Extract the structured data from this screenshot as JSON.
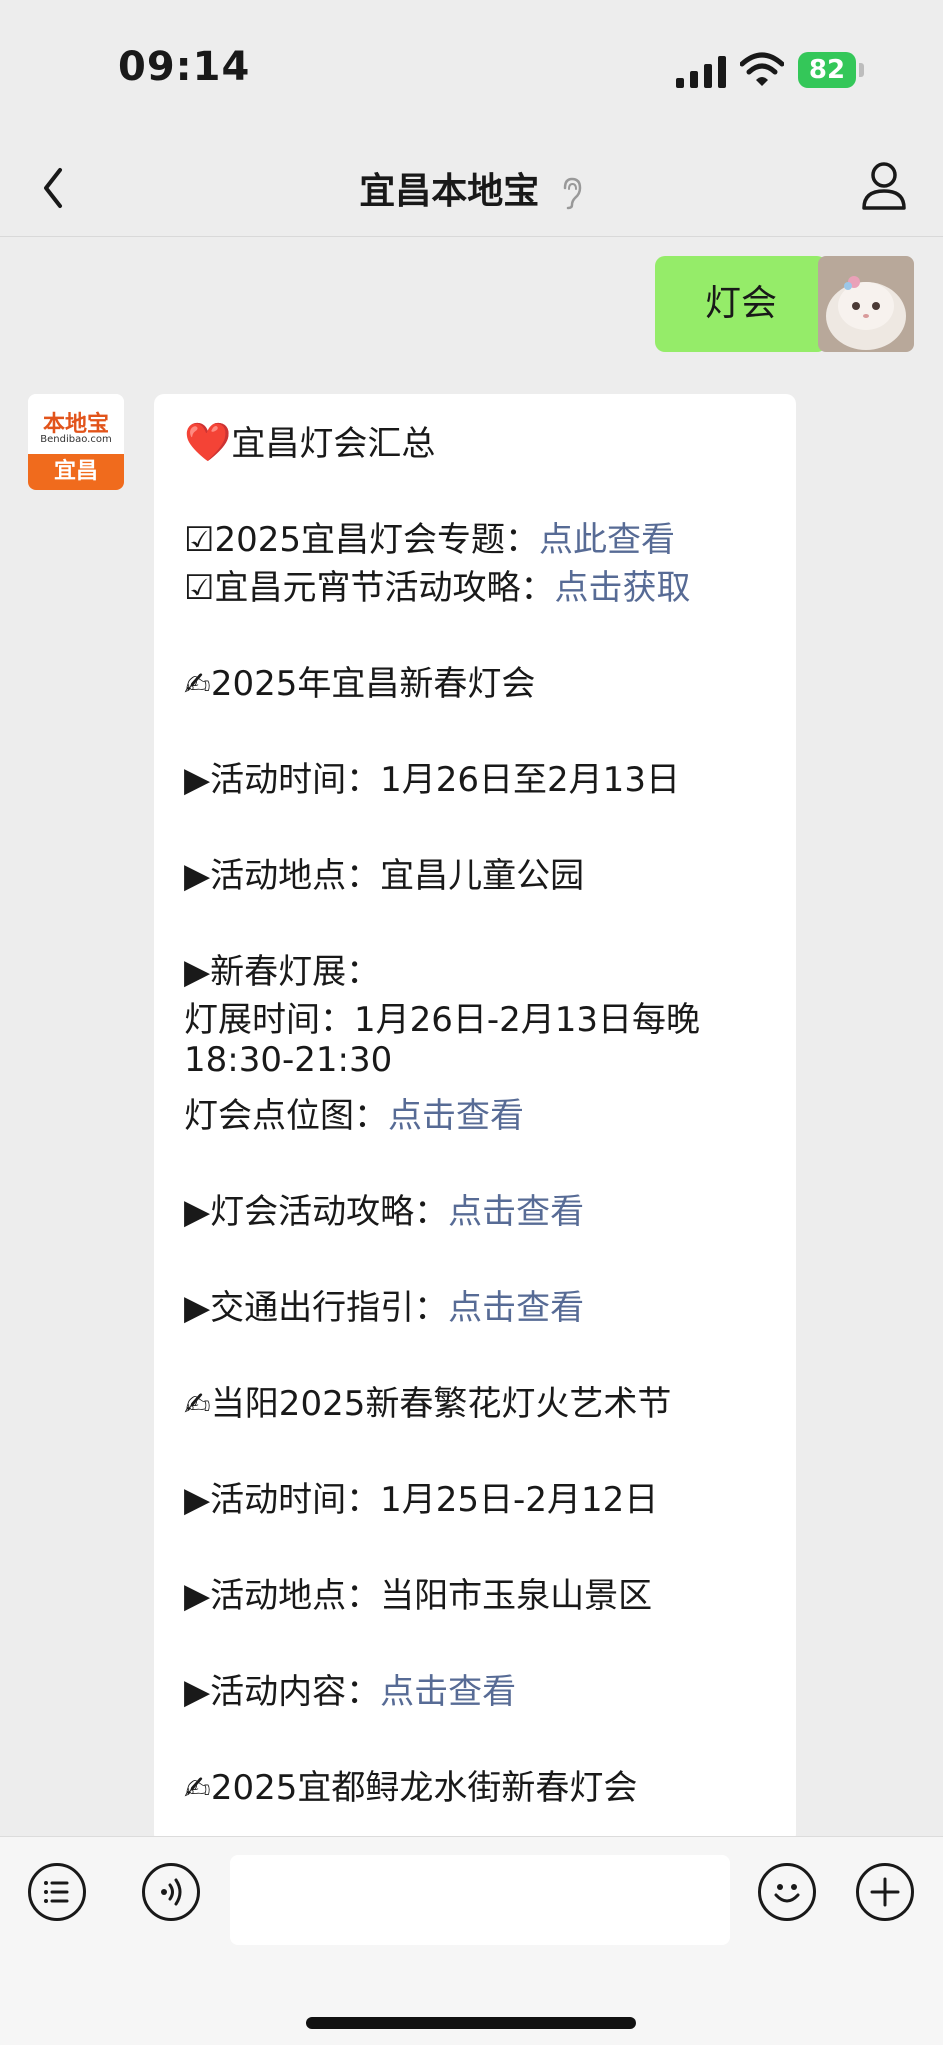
{
  "status": {
    "time": "09:14",
    "battery": "82"
  },
  "nav": {
    "title": "宜昌本地宝"
  },
  "user_message": {
    "text": "灯会"
  },
  "bot": {
    "avatar_name": "本地宝",
    "avatar_domain": "Bendibao.com",
    "avatar_city": "宜昌",
    "lines": [
      {
        "prefix": "❤️",
        "text": "宜昌灯会汇总",
        "link": ""
      },
      {
        "prefix": "☑",
        "text": "2025宜昌灯会专题：",
        "link": "点此查看"
      },
      {
        "prefix": "☑",
        "text": "宜昌元宵节活动攻略：",
        "link": "点击获取"
      },
      {
        "prefix": "✍",
        "text": "2025年宜昌新春灯会",
        "link": ""
      },
      {
        "prefix": "▶",
        "text": "活动时间：1月26日至2月13日",
        "link": ""
      },
      {
        "prefix": "▶",
        "text": "活动地点：宜昌儿童公园",
        "link": ""
      },
      {
        "prefix": "▶",
        "text": "新春灯展：",
        "link": ""
      },
      {
        "prefix": "",
        "text": "灯展时间：1月26日-2月13日每晚",
        "link": ""
      },
      {
        "prefix": "",
        "text": "18:30-21:30",
        "link": ""
      },
      {
        "prefix": "",
        "text": "灯会点位图：",
        "link": "点击查看"
      },
      {
        "prefix": "▶",
        "text": "灯会活动攻略：",
        "link": "点击查看"
      },
      {
        "prefix": "▶",
        "text": "交通出行指引：",
        "link": "点击查看"
      },
      {
        "prefix": "✍",
        "text": "当阳2025新春繁花灯火艺术节",
        "link": ""
      },
      {
        "prefix": "▶",
        "text": "活动时间：1月25日-2月12日",
        "link": ""
      },
      {
        "prefix": "▶",
        "text": "活动地点：当阳市玉泉山景区",
        "link": ""
      },
      {
        "prefix": "▶",
        "text": "活动内容：",
        "link": "点击查看"
      },
      {
        "prefix": "✍",
        "text": "2025宜都鲟龙水街新春灯会",
        "link": ""
      }
    ]
  },
  "input": {
    "value": "",
    "placeholder": ""
  },
  "colors": {
    "outgoing_bubble": "#95ec69",
    "link": "#576b95",
    "background": "#ededed",
    "battery": "#34c759"
  },
  "icons": [
    "back-chevron-icon",
    "ear-icon",
    "profile-icon",
    "list-icon",
    "voice-icon",
    "emoji-icon",
    "plus-icon"
  ]
}
